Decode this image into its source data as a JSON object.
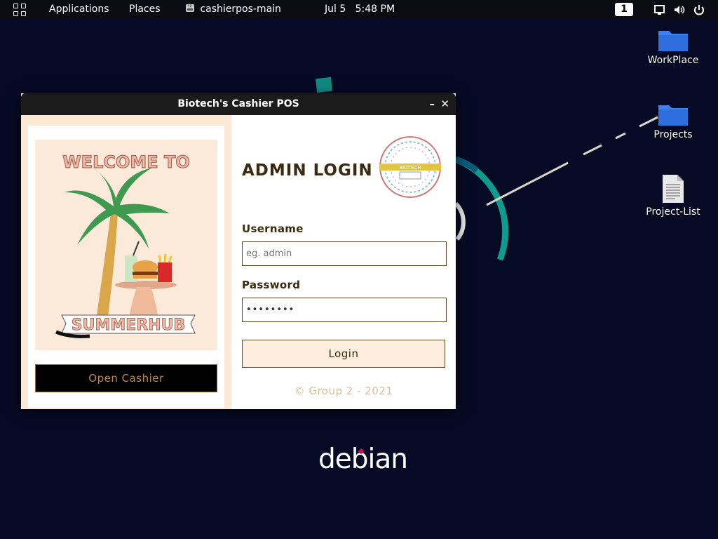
{
  "topbar": {
    "applications": "Applications",
    "places": "Places",
    "active_app": "cashierpos-main",
    "date": "Jul 5",
    "time": "5:48 PM",
    "workspace": "1",
    "icons": [
      "app-grid-icon",
      "java-icon",
      "screen-icon",
      "volume-icon",
      "power-icon"
    ]
  },
  "desktop": {
    "icons": [
      {
        "label": "WorkPlace",
        "icon": "folder-icon"
      },
      {
        "label": "Projects",
        "icon": "folder-icon"
      },
      {
        "label": "Project-List",
        "icon": "text-file-icon"
      }
    ],
    "wallpaper_logo": "debian"
  },
  "window": {
    "title": "Biotech's Cashier POS",
    "minimize": "–",
    "close": "✕",
    "poster": {
      "top_text": "WELCOME TO",
      "banner_text": "SUMMERHUB"
    },
    "open_cashier": "Open Cashier",
    "heading": "ADMIN LOGIN",
    "emblem_text": "BIOTECH",
    "username_label": "Username",
    "username_placeholder": "eg. admin",
    "password_label": "Password",
    "password_value": "••••••••",
    "login_button": "Login",
    "footer": "© Group 2 - 2021"
  },
  "colors": {
    "wallpaper": "#070a24",
    "accent_brown": "#3a2a10",
    "panel_beige": "#fbe9d5",
    "teal_arc": "#0f9a8e"
  }
}
